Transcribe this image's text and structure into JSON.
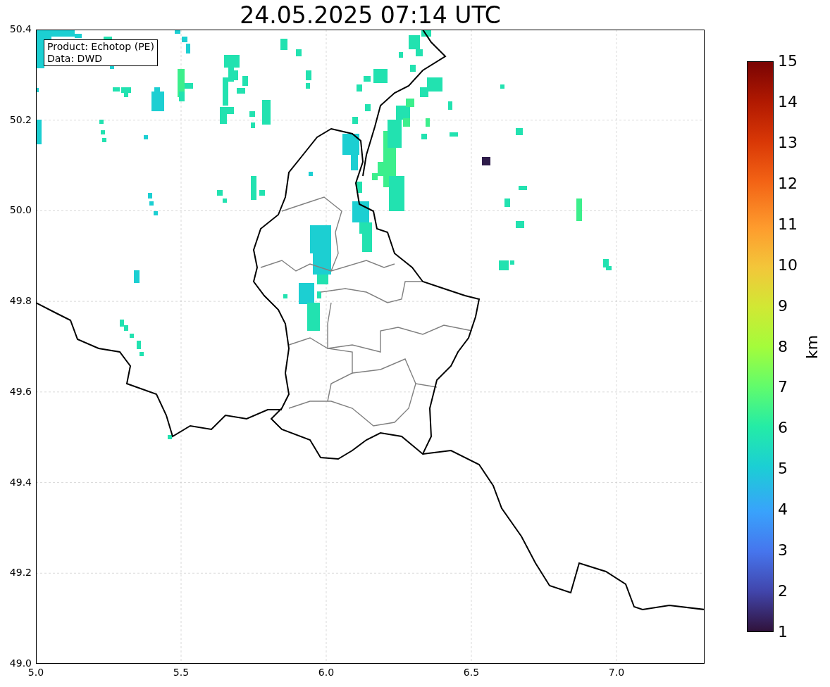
{
  "title": "24.05.2025 07:14 UTC",
  "info_box": [
    "Product: Echotop (PE)",
    "Data: DWD"
  ],
  "x_ticks": [
    "5.0",
    "5.5",
    "6.0",
    "6.5",
    "7.0"
  ],
  "y_ticks": [
    "50.4",
    "50.2",
    "50.0",
    "49.8",
    "49.6",
    "49.4",
    "49.2",
    "49.0"
  ],
  "colorbar": {
    "label": "km",
    "ticks": [
      "15",
      "14",
      "13",
      "12",
      "11",
      "10",
      "9",
      "8",
      "7",
      "6",
      "5",
      "4",
      "3",
      "2",
      "1"
    ]
  }
}
